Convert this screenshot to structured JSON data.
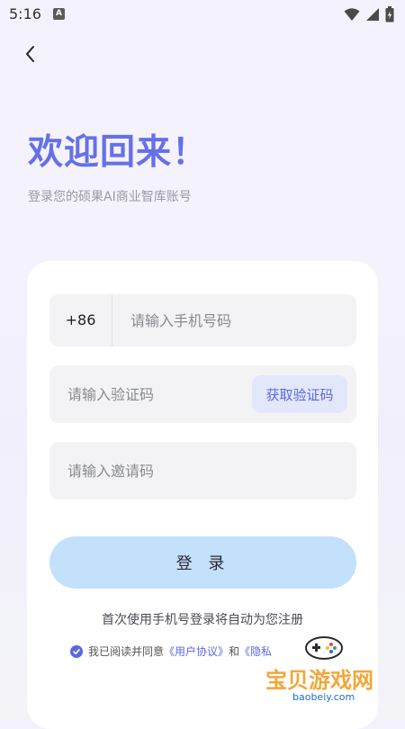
{
  "status_bar": {
    "time": "5:16",
    "notification_icon_letter": "A"
  },
  "header": {
    "title": "欢迎回来！",
    "subtitle": "登录您的硕果AI商业智库账号"
  },
  "form": {
    "country_code": "+86",
    "phone_placeholder": "请输入手机号码",
    "code_placeholder": "请输入验证码",
    "get_code_label": "获取验证码",
    "invite_placeholder": "请输入邀请码",
    "login_label": "登 录",
    "auto_register_note": "首次使用手机号登录将自动为您注册",
    "agreement_prefix": "我已阅读并同意",
    "user_agreement": "《用户协议》",
    "agreement_and": "和",
    "privacy_policy_partial": "《隐私"
  },
  "watermark": {
    "text": "宝贝游戏网",
    "url": "baobeiy.com"
  },
  "colors": {
    "accent": "#6570e8",
    "login_button_bg": "#c4e1fb",
    "get_code_bg": "#e3e7fb"
  }
}
